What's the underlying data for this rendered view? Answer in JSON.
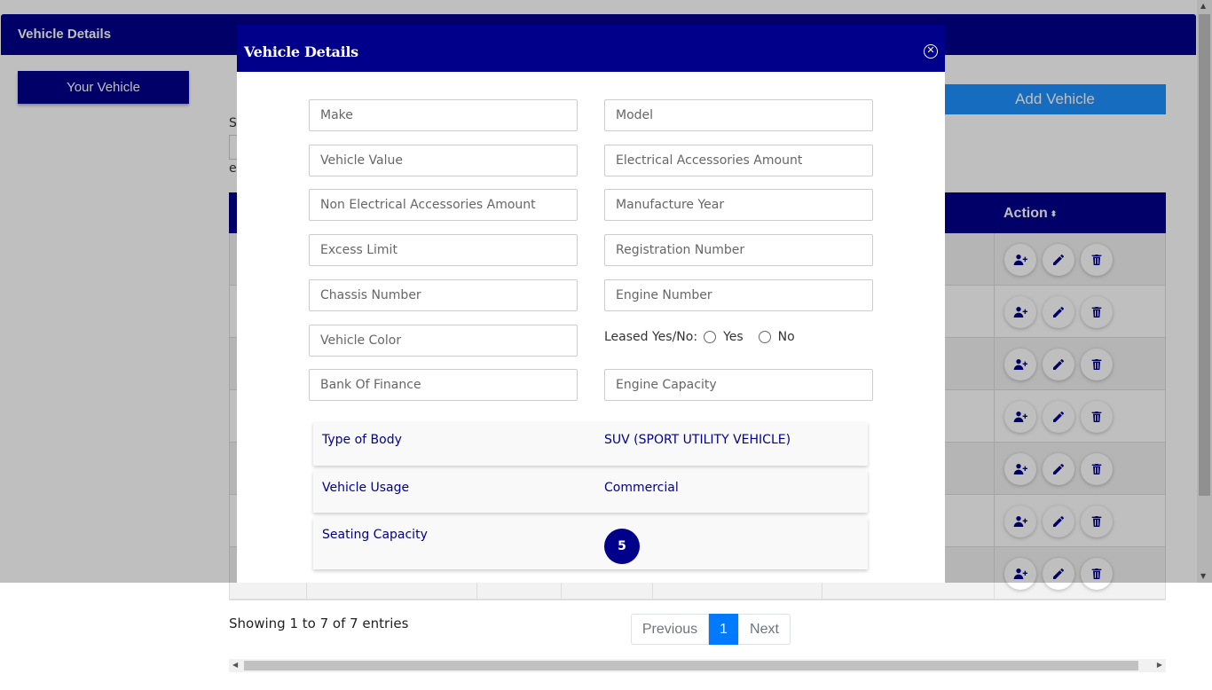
{
  "page": {
    "topbar_title": "Vehicle Details",
    "your_vehicle_label": "Your Vehicle",
    "add_vehicle_label": "Add Vehicle",
    "search_fragment": "S",
    "entries_fragment": "e",
    "action_header": "Action",
    "sort_glyph": "⬍",
    "row_count": 7,
    "row_actions": [
      "add-user-icon",
      "pencil-icon",
      "trash-icon"
    ],
    "showing_text": "Showing 1 to 7 of 7 entries",
    "pagination": {
      "previous": "Previous",
      "current": "1",
      "next": "Next"
    }
  },
  "modal": {
    "title": "Vehicle Details",
    "close_glyph": "✕",
    "fields": {
      "make": "Make",
      "model": "Model",
      "vehicle_value": "Vehicle Value",
      "electrical_accessories_amount": "Electrical Accessories Amount",
      "non_electrical_accessories_amount": "Non Electrical Accessories Amount",
      "manufacture_year": "Manufacture Year",
      "excess_limit": "Excess Limit",
      "registration_number": "Registration Number",
      "chassis_number": "Chassis Number",
      "engine_number": "Engine Number",
      "vehicle_color": "Vehicle Color",
      "bank_of_finance": "Bank Of Finance",
      "engine_capacity": "Engine Capacity"
    },
    "leased": {
      "label": "Leased Yes/No:",
      "yes": "Yes",
      "no": "No"
    },
    "type_of_body": {
      "label": "Type of Body",
      "value": "SUV (SPORT UTILITY VEHICLE)"
    },
    "vehicle_usage": {
      "label": "Vehicle Usage",
      "value": "Commercial"
    },
    "seating_capacity": {
      "label": "Seating Capacity",
      "value": "5"
    }
  },
  "colors": {
    "primary": "#00008b",
    "accent": "#1e90ff",
    "pager_active": "#007bff"
  }
}
